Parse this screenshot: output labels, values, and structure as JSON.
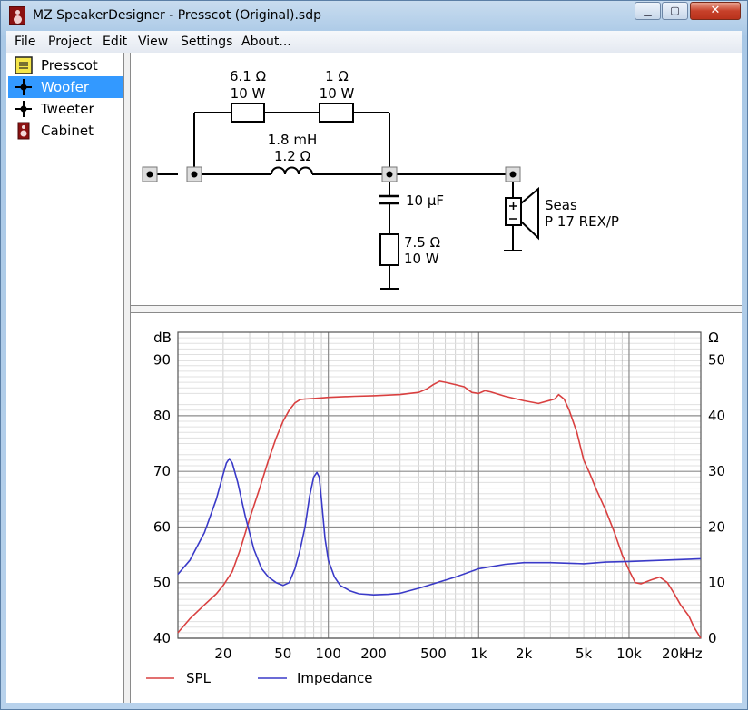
{
  "window": {
    "title": "MZ SpeakerDesigner - Presscot (Original).sdp",
    "min_symbol": "▁",
    "max_symbol": "▢",
    "close_symbol": "✕"
  },
  "menu": [
    "File",
    "Project",
    "Edit",
    "View",
    "Settings",
    "About..."
  ],
  "tree": {
    "items": [
      {
        "label": "Presscot",
        "icon": "project-note-icon",
        "selected": false
      },
      {
        "label": "Woofer",
        "icon": "driver-node-icon",
        "selected": true
      },
      {
        "label": "Tweeter",
        "icon": "driver-node-icon",
        "selected": false
      },
      {
        "label": "Cabinet",
        "icon": "cabinet-icon",
        "selected": false
      }
    ]
  },
  "schematic": {
    "r1": {
      "value": "6.1 Ω",
      "power": "10 W"
    },
    "r2": {
      "value": "1 Ω",
      "power": "10 W"
    },
    "inductor": {
      "value": "1.8 mH",
      "resistance": "1.2 Ω"
    },
    "capacitor": {
      "value": "10 µF"
    },
    "r3": {
      "value": "7.5 Ω",
      "power": "10 W"
    },
    "driver": {
      "brand": "Seas",
      "model": "P 17 REX/P"
    }
  },
  "chart_data": {
    "type": "line",
    "xscale": "log",
    "xlim": [
      10,
      30000
    ],
    "xunit": "Hz",
    "xticks": [
      20,
      50,
      100,
      200,
      500,
      1000,
      2000,
      5000,
      10000,
      20000
    ],
    "xtick_labels": [
      "20",
      "50",
      "100",
      "200",
      "500",
      "1k",
      "2k",
      "5k",
      "10k",
      "20k"
    ],
    "y_left": {
      "label": "dB",
      "lim": [
        40,
        95
      ],
      "ticks": [
        40,
        50,
        60,
        70,
        80,
        90
      ]
    },
    "y_right": {
      "label": "Ω",
      "lim": [
        0,
        55
      ],
      "ticks": [
        0,
        10,
        20,
        30,
        40,
        50
      ]
    },
    "grid": true,
    "legend_position": "bottom-left",
    "series": [
      {
        "name": "SPL",
        "axis": "left",
        "color": "#d94040",
        "x": [
          10,
          12,
          15,
          18,
          20,
          23,
          26,
          30,
          35,
          40,
          45,
          50,
          55,
          60,
          65,
          70,
          80,
          90,
          100,
          150,
          200,
          300,
          400,
          450,
          500,
          550,
          600,
          700,
          800,
          900,
          1000,
          1100,
          1200,
          1500,
          2000,
          2500,
          3000,
          3200,
          3400,
          3700,
          4000,
          4500,
          5000,
          5500,
          6000,
          7000,
          8000,
          9000,
          10000,
          11000,
          12000,
          14000,
          16000,
          18000,
          20000,
          22000,
          25000,
          27000,
          30000
        ],
        "y": [
          41,
          43.5,
          46,
          48,
          49.5,
          52,
          56,
          61.5,
          67,
          72,
          76,
          79,
          81,
          82.3,
          82.9,
          83,
          83.1,
          83.2,
          83.3,
          83.5,
          83.6,
          83.8,
          84.2,
          84.8,
          85.6,
          86.2,
          86,
          85.6,
          85.2,
          84.2,
          84,
          84.5,
          84.3,
          83.5,
          82.7,
          82.2,
          82.8,
          83,
          83.8,
          83,
          81,
          77,
          72,
          69.5,
          67,
          63,
          59,
          55,
          52.2,
          50,
          49.8,
          50.5,
          51,
          50,
          48,
          46,
          44,
          42,
          39
        ]
      },
      {
        "name": "Impedance",
        "axis": "right",
        "color": "#3a3ac8",
        "x": [
          10,
          12,
          15,
          18,
          20,
          21,
          22,
          23,
          25,
          28,
          32,
          36,
          40,
          45,
          50,
          55,
          60,
          65,
          70,
          75,
          80,
          84,
          87,
          90,
          95,
          100,
          110,
          120,
          140,
          160,
          200,
          250,
          300,
          400,
          500,
          700,
          1000,
          1500,
          2000,
          3000,
          5000,
          7000,
          10000,
          20000,
          30000
        ],
        "y": [
          11.5,
          14,
          19,
          25,
          29.5,
          31.5,
          32.3,
          31.5,
          28,
          22,
          16,
          12.5,
          11,
          10,
          9.5,
          10,
          12.5,
          16,
          20,
          25.5,
          29,
          29.8,
          29,
          25,
          18,
          14,
          11,
          9.5,
          8.5,
          8,
          7.8,
          7.9,
          8.1,
          9,
          9.8,
          11,
          12.5,
          13.3,
          13.6,
          13.6,
          13.4,
          13.7,
          13.8,
          14.1,
          14.3
        ]
      }
    ]
  }
}
